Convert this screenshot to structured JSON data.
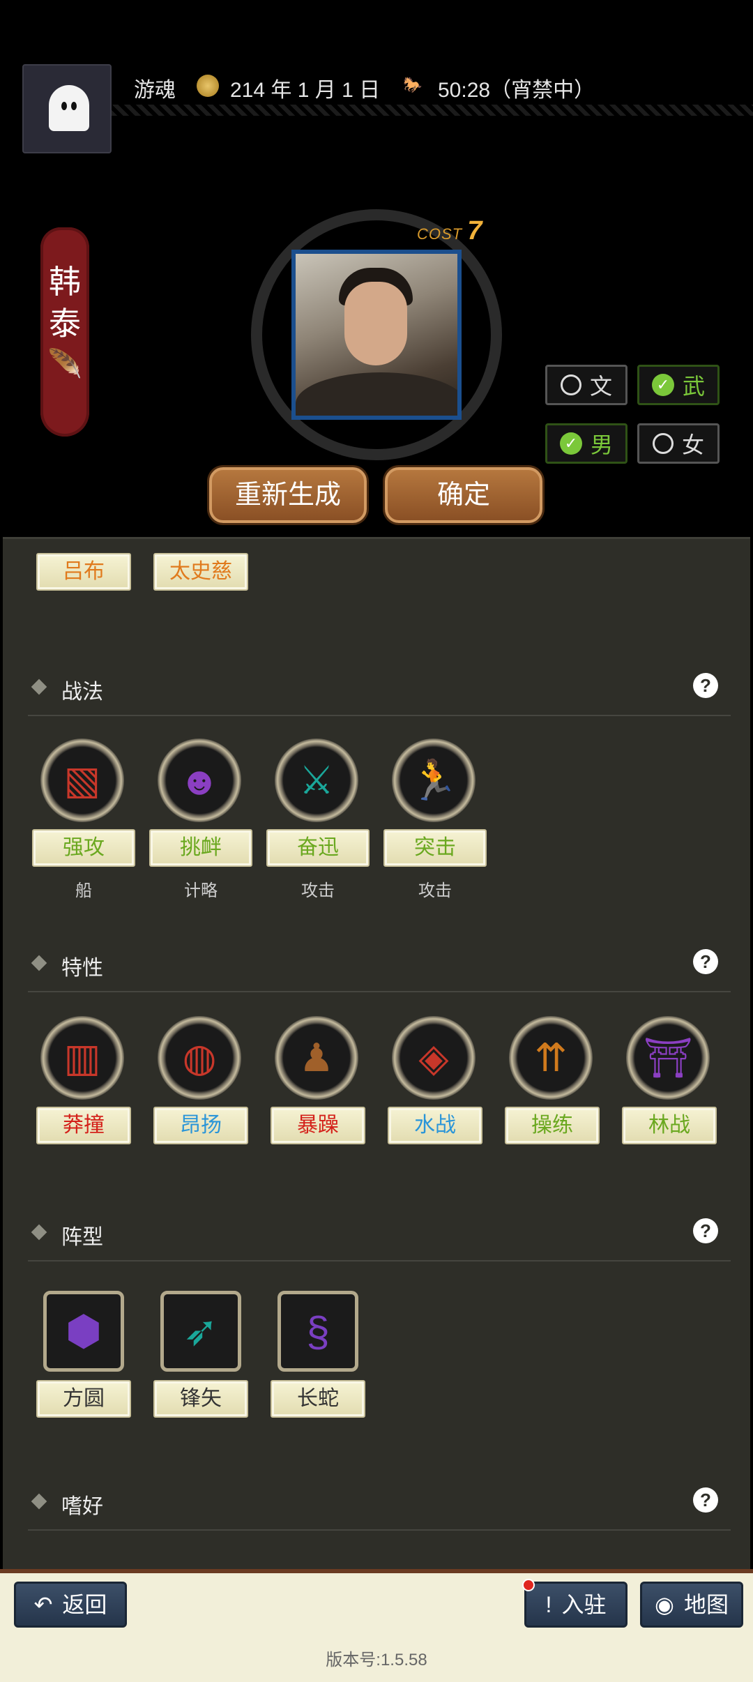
{
  "header": {
    "player_name": "游魂",
    "date": "214 年 1 月 1 日",
    "timer": "50:28（宵禁中）"
  },
  "character": {
    "name_line1": "韩",
    "name_line2": "泰",
    "cost_label": "COST",
    "cost_value": "7"
  },
  "toggles": {
    "wen": "文",
    "wu": "武",
    "male": "男",
    "female": "女",
    "selected": [
      "武",
      "男"
    ]
  },
  "actions": {
    "regenerate": "重新生成",
    "confirm": "确定"
  },
  "related": [
    "吕布",
    "太史慈"
  ],
  "sections": {
    "tactics": "战法",
    "traits": "特性",
    "formations": "阵型",
    "hobbies": "嗜好"
  },
  "tactics": [
    {
      "label": "强攻",
      "type": "船"
    },
    {
      "label": "挑衅",
      "type": "计略"
    },
    {
      "label": "奋迅",
      "type": "攻击"
    },
    {
      "label": "突击",
      "type": "攻击"
    }
  ],
  "traits": [
    "莽撞",
    "昂扬",
    "暴躁",
    "水战",
    "操练",
    "林战"
  ],
  "formations": [
    "方圆",
    "锋矢",
    "长蛇"
  ],
  "bottom": {
    "back": "返回",
    "station": "入驻",
    "map": "地图",
    "version": "版本号:1.5.58"
  },
  "colors": {
    "accent_green": "#7bc83a",
    "panel_bg": "#2e2e28",
    "banner_red": "#7d1a1d"
  }
}
